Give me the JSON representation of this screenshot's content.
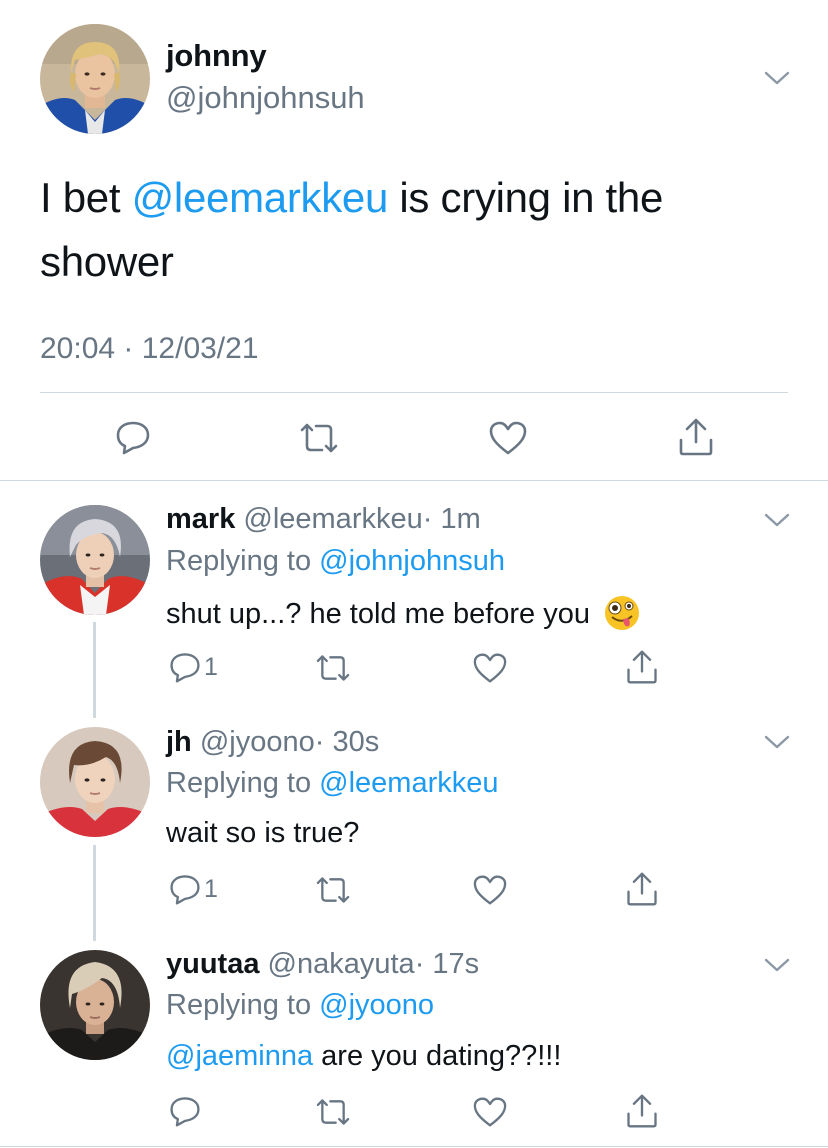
{
  "main_tweet": {
    "name": "johnny",
    "handle": "@johnjohnsuh",
    "text_before": "I bet ",
    "mention": "@leemarkkeu",
    "text_after": " is crying in the shower",
    "timestamp": "20:04 · 12/03/21"
  },
  "replies": [
    {
      "name": "mark",
      "handle": "@leemarkkeu",
      "time": "· 1m",
      "replying_label": "Replying to ",
      "replying_to": "@johnjohnsuh",
      "text": "shut up...? he told me before you",
      "emoji": "zany-face",
      "reply_count": "1"
    },
    {
      "name": "jh",
      "handle": "@jyoono",
      "time": "· 30s",
      "replying_label": "Replying to ",
      "replying_to": "@leemarkkeu",
      "text": "wait so is true?",
      "reply_count": "1"
    },
    {
      "name": "yuutaa",
      "handle": "@nakayuta",
      "time": "· 17s",
      "replying_label": "Replying to ",
      "replying_to": "@jyoono",
      "mention": "@jaeminna",
      "text": " are you dating??!!!",
      "reply_count": ""
    }
  ],
  "icons": {
    "reply": "reply-icon",
    "retweet": "retweet-icon",
    "like": "like-icon",
    "share": "share-icon",
    "more": "chevron-down-icon"
  },
  "colors": {
    "mention": "#1d9bf0",
    "secondary_text": "#687684",
    "divider": "#cfd9de"
  }
}
